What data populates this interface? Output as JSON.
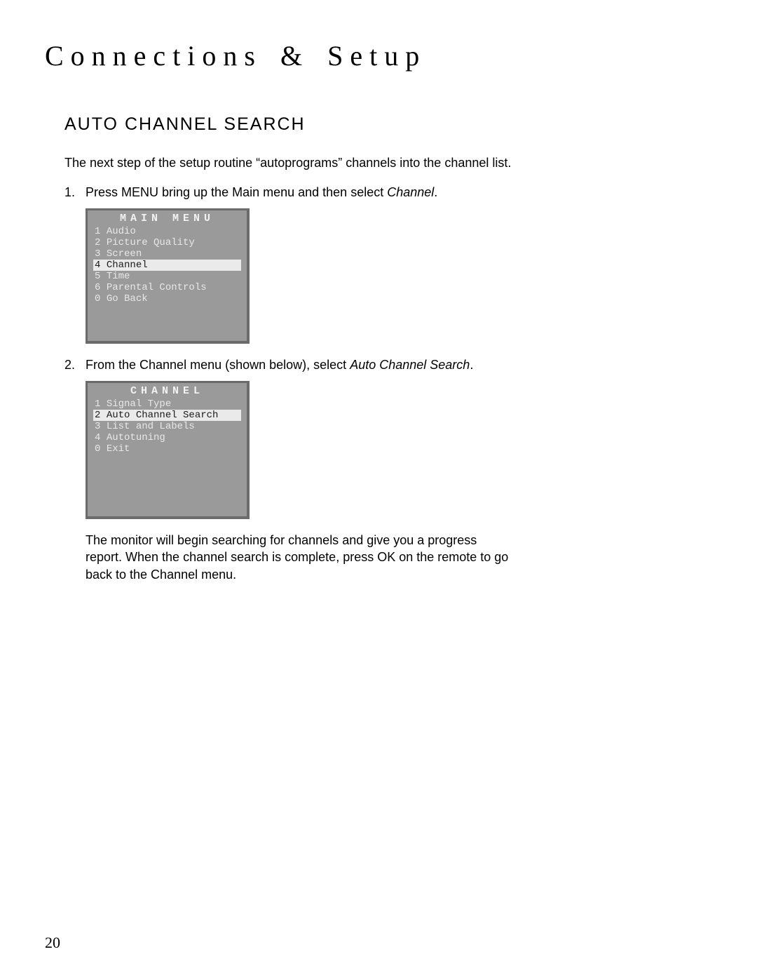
{
  "chapter_title": "Connections & Setup",
  "section_title": "AUTO CHANNEL SEARCH",
  "intro": "The next step of the setup routine “autoprograms” channels into the channel list.",
  "steps": [
    {
      "num": "1.",
      "pre": "Press MENU bring up the Main menu and then select ",
      "em": "Channel",
      "post": "."
    },
    {
      "num": "2.",
      "pre": "From the Channel menu (shown below), select ",
      "em": "Auto Channel Search",
      "post": "."
    }
  ],
  "main_menu": {
    "title": "MAIN MENU",
    "items": [
      {
        "n": "1",
        "label": "Audio",
        "selected": false
      },
      {
        "n": "2",
        "label": "Picture Quality",
        "selected": false
      },
      {
        "n": "3",
        "label": "Screen",
        "selected": false
      },
      {
        "n": "4",
        "label": "Channel",
        "selected": true
      },
      {
        "n": "5",
        "label": "Time",
        "selected": false
      },
      {
        "n": "6",
        "label": "Parental Controls",
        "selected": false
      },
      {
        "n": "0",
        "label": "Go Back",
        "selected": false
      }
    ]
  },
  "channel_menu": {
    "title": "CHANNEL",
    "items": [
      {
        "n": "1",
        "label": "Signal Type",
        "selected": false
      },
      {
        "n": "2",
        "label": "Auto Channel Search",
        "selected": true
      },
      {
        "n": "3",
        "label": "List and Labels",
        "selected": false
      },
      {
        "n": "4",
        "label": "Autotuning",
        "selected": false
      },
      {
        "n": "0",
        "label": "Exit",
        "selected": false
      }
    ]
  },
  "outro": "The monitor will begin searching for channels and give you a progress report. When the channel search is complete, press OK on the remote to go back to the Channel menu.",
  "page_number": "20"
}
